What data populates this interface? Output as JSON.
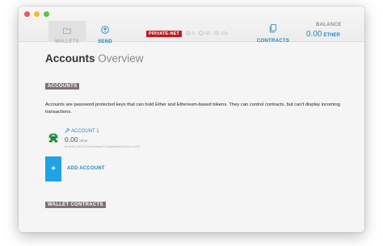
{
  "window": {
    "traffic_lights": [
      "close",
      "minimize",
      "zoom"
    ]
  },
  "nav": {
    "wallets": {
      "label": "WALLETS",
      "icon": "folder-icon"
    },
    "send": {
      "label": "SEND",
      "icon": "arrow-up-circle-icon"
    },
    "contracts": {
      "label": "CONTRACTS",
      "icon": "document-stack-icon"
    }
  },
  "status": {
    "network": "PRIVATE-NET",
    "peers": "0",
    "block": "93",
    "time": "32s"
  },
  "balance": {
    "label": "BALANCE",
    "value": "0.00",
    "unit": "ETHER"
  },
  "page": {
    "title_bold": "Accounts",
    "title_light": " Overview"
  },
  "accounts_section": {
    "tag": "ACCOUNTS",
    "description": "Accounts are password protected keys that can hold Ether and Ethereum-based tokens. They can control contracts, but can't display incoming transactions.",
    "items": [
      {
        "name": "ACCOUNT 1",
        "balance": "0.00",
        "unit": "ether",
        "address": "0x0b85c2a37b12ce0c9aa2f1c8d3a6b0f5e41cc7b58"
      }
    ],
    "add_label": "ADD ACCOUNT",
    "add_symbol": "+"
  },
  "wallet_contracts": {
    "tag": "WALLET CONTRACTS"
  },
  "colors": {
    "accent": "#1e89c8",
    "network_badge": "#c11a1f",
    "tag_bg": "#7f7272",
    "add_button": "#1fa2e8"
  }
}
